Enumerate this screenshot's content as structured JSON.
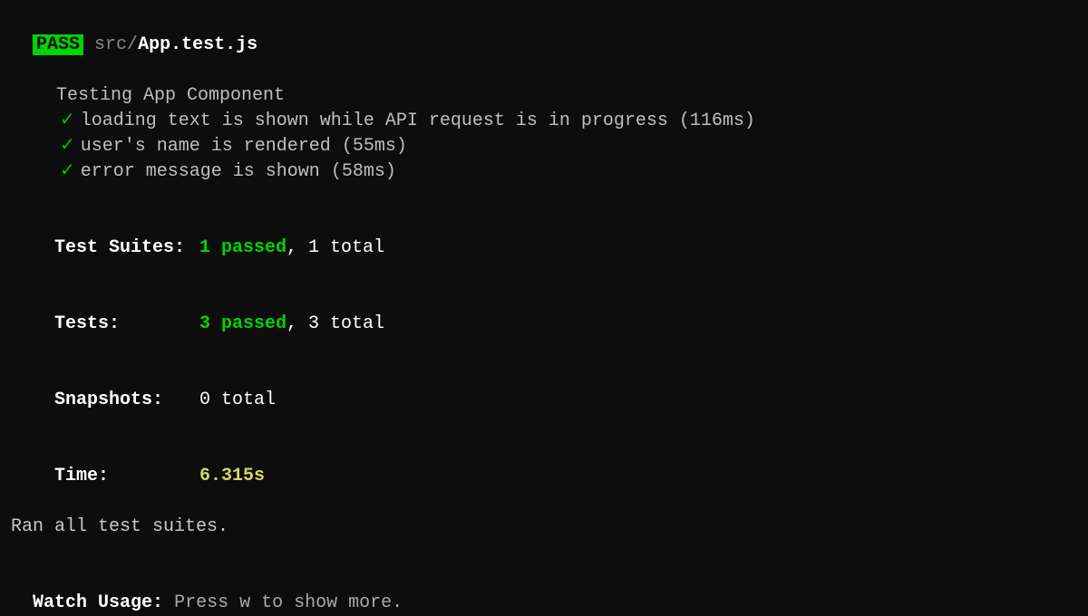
{
  "header": {
    "badge": "PASS",
    "file_dir": "src/",
    "file_name": "App.test.js"
  },
  "describe": {
    "name": "Testing App Component"
  },
  "tests": [
    {
      "status": "pass",
      "desc": "loading text is shown while API request is in progress",
      "time": "(116ms)"
    },
    {
      "status": "pass",
      "desc": "user's name is rendered",
      "time": "(55ms)"
    },
    {
      "status": "pass",
      "desc": "error message is shown",
      "time": "(58ms)"
    }
  ],
  "summary": {
    "test_suites_label": "Test Suites:",
    "test_suites_passed": "1 passed",
    "test_suites_total": "1 total",
    "tests_label": "Tests:",
    "tests_passed": "3 passed",
    "tests_total": "3 total",
    "snapshots_label": "Snapshots:",
    "snapshots_total": "0 total",
    "time_label": "Time:",
    "time_value": "6.315s",
    "ran_message": "Ran all test suites."
  },
  "watch": {
    "label": "Watch Usage:",
    "text": "Press w to show more."
  },
  "glyphs": {
    "check": "✓",
    "comma": ", "
  }
}
